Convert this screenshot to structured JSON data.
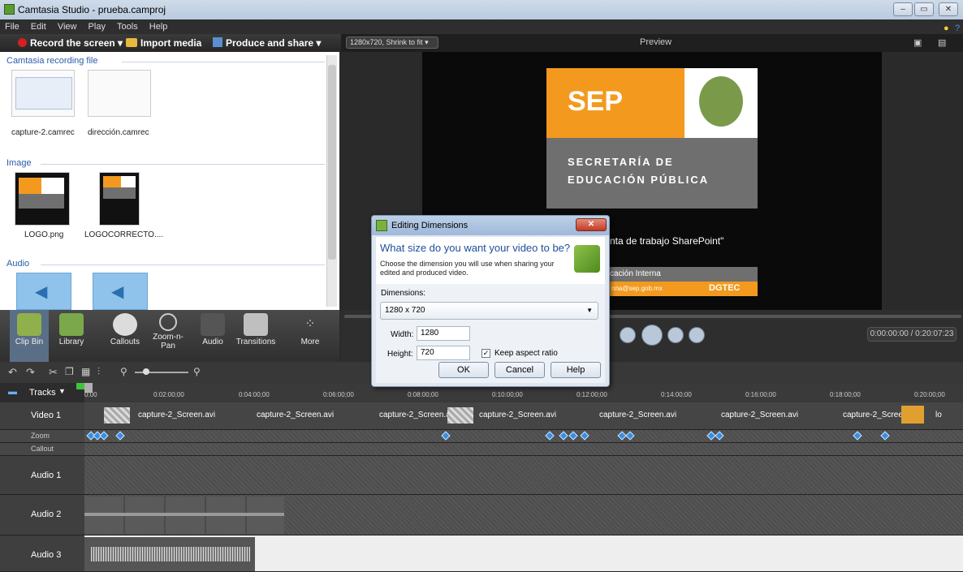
{
  "window": {
    "title": "Camtasia Studio - prueba.camproj"
  },
  "menu": [
    "File",
    "Edit",
    "View",
    "Play",
    "Tools",
    "Help"
  ],
  "toolbar": {
    "record": "Record the screen",
    "import": "Import media",
    "produce": "Produce and share"
  },
  "clipbin": {
    "sections": {
      "recording": "Camtasia recording file",
      "image": "Image",
      "audio": "Audio"
    },
    "recordings": [
      "capture-2.camrec",
      "dirección.camrec"
    ],
    "images": [
      "LOGO.png",
      "LOGOCORRECTO...."
    ]
  },
  "tools": {
    "clipbin": "Clip Bin",
    "library": "Library",
    "callouts": "Callouts",
    "zoom": "Zoom-n-Pan",
    "audio": "Audio",
    "transitions": "Transitions",
    "more": "More"
  },
  "preview": {
    "size_select": "1280x720, Shrink to fit",
    "title": "Preview",
    "timecode": "0:00:00:00 / 0:20:07:23",
    "video": {
      "logo": "SEP",
      "secretaria1": "SECRETARÍA DE",
      "secretaria2": "EDUCACIÓN PÚBLICA",
      "sharepoint": "nta de trabajo SharePoint\"",
      "comunicacion": "cación Interna",
      "email": "nna@sep.gob.mx",
      "dgtec": "DGTEC"
    }
  },
  "timeline": {
    "tracks_label": "Tracks",
    "ruler": [
      "0:00",
      "0:02:00;00",
      "0:04:00;00",
      "0:06:00;00",
      "0:08:00;00",
      "0:10:00;00",
      "0:12:00;00",
      "0:14:00;00",
      "0:16:00;00",
      "0:18:00;00",
      "0:20:00;00"
    ],
    "tracks": {
      "video1": "Video 1",
      "zoom": "Zoom",
      "callout": "Callout",
      "audio1": "Audio 1",
      "audio2": "Audio 2",
      "audio3": "Audio 3"
    },
    "clips": [
      "capture-2_Screen.avi",
      "capture-2_Screen.avi",
      "capture-2_Screen.a",
      "capture-2_Screen.avi",
      "capture-2_Screen.avi",
      "capture-2_Screen.avi",
      "capture-2_Screen",
      "lo"
    ]
  },
  "dialog": {
    "title": "Editing Dimensions",
    "heading": "What size do you want your video to be?",
    "description": "Choose the dimension you will use when sharing your edited and produced video.",
    "dimensions_label": "Dimensions:",
    "dimensions_value": "1280 x 720",
    "width_label": "Width:",
    "width_value": "1280",
    "height_label": "Height:",
    "height_value": "720",
    "keep_aspect": "Keep aspect ratio",
    "ok": "OK",
    "cancel": "Cancel",
    "help": "Help"
  },
  "colors": {
    "accent": "#3a8ee0",
    "sep_orange": "#f39a1e",
    "sep_gray": "#6f6f6f",
    "record_red": "#d42020"
  }
}
